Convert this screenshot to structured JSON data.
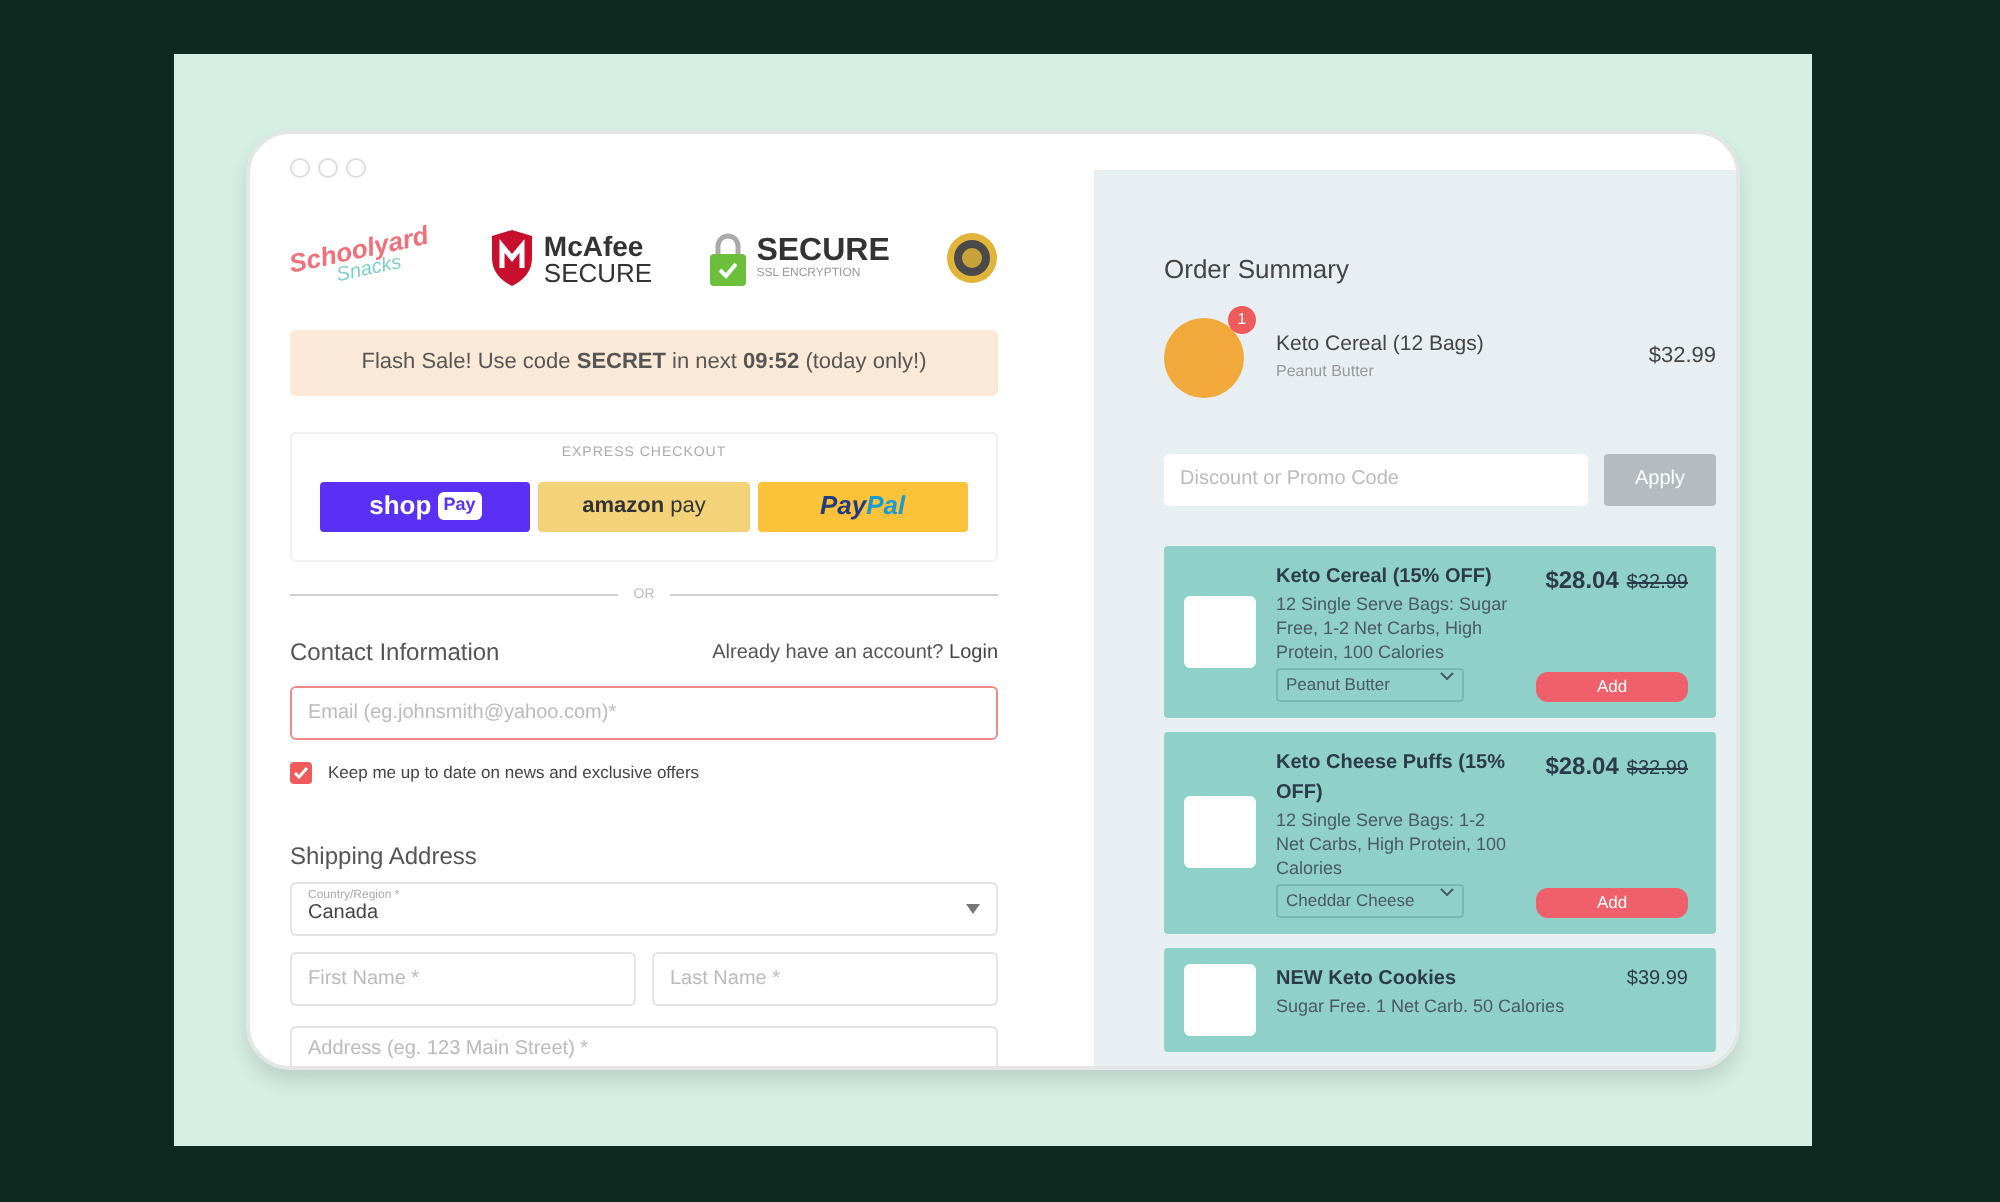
{
  "logos": {
    "brand_top": "Schoolyard",
    "brand_bottom": "Snacks",
    "mcafee_name": "McAfee",
    "mcafee_tag": "SECURE",
    "ssl_title": "SECURE",
    "ssl_sub": "SSL ENCRYPTION"
  },
  "flash_sale": "Flash Sale! Use code **SECRET** in next **09:52** (today only!)",
  "express_checkout": {
    "label": "EXPRESS CHECKOUT",
    "buttons": [
      {
        "kind": "shop",
        "text": "shop",
        "badge": "Pay"
      },
      {
        "kind": "amazon",
        "text": "amazon",
        "suffix": "pay"
      },
      {
        "kind": "paypal",
        "text": "Pay",
        "suffix": "Pal"
      }
    ]
  },
  "divider": "OR",
  "contact": {
    "title": "Contact Information",
    "account_prompt": "Already have an account?",
    "login": "Login",
    "email": {
      "placeholder": "Email (eg.johnsmith@yahoo.com)*",
      "invalid": true
    },
    "newsletter": {
      "label": "Keep me up to date on news and exclusive offers",
      "checked": true
    }
  },
  "shipping": {
    "title": "Shipping Address",
    "country": {
      "label": "Country/Region *",
      "value": "Canada"
    },
    "first_name": {
      "placeholder": "First Name *"
    },
    "last_name": {
      "placeholder": "Last Name *"
    },
    "address": {
      "placeholder": "Address (eg. 123 Main Street) *"
    }
  },
  "order_summary": {
    "title": "Order Summary",
    "items": [
      {
        "name": "Keto Cereal (12 Bags)",
        "variant": "Peanut Butter",
        "price": "$32.99",
        "quantity": "1"
      }
    ],
    "promo": {
      "placeholder": "Discount or Promo Code",
      "button": "Apply",
      "disabled": true
    },
    "upsells": [
      {
        "name": "Keto Cereal (15% OFF)",
        "description": "12 Single Serve Bags: Sugar Free, 1-2 Net Carbs, High Protein, 100 Calories",
        "price": "$28.04",
        "old_price": "$32.99",
        "variant": "Peanut Butter",
        "button": "Add"
      },
      {
        "name": "Keto Cheese Puffs (15% OFF)",
        "description": "12 Single Serve Bags: 1-2 Net Carbs, High Protein, 100 Calories",
        "price": "$28.04",
        "old_price": "$32.99",
        "variant": "Cheddar Cheese",
        "button": "Add"
      },
      {
        "name": "NEW Keto Cookies",
        "description": "Sugar Free. 1 Net Carb. 50 Calories",
        "price": "$39.99"
      }
    ]
  }
}
